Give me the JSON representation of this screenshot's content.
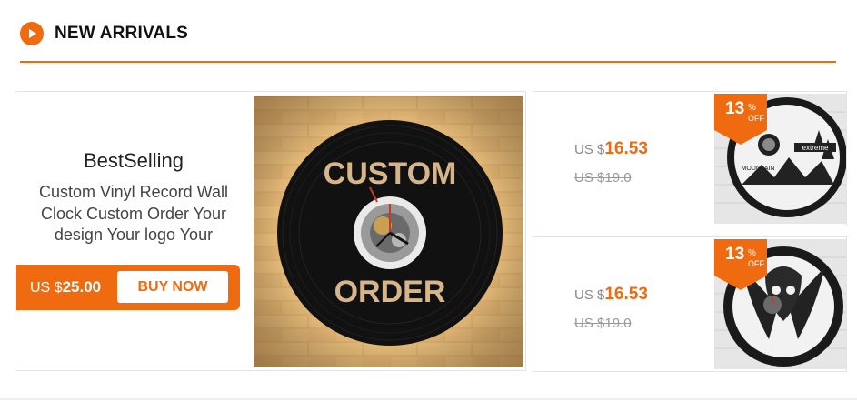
{
  "section": {
    "title": "NEW ARRIVALS",
    "icon": "play-circle-icon",
    "accent_color": "#f06a10"
  },
  "featured": {
    "title": "BestSelling",
    "description": "Custom Vinyl Record Wall Clock Custom Order Your design Your logo Your",
    "currency": "US $",
    "price": "25.00",
    "button_label": "BUY NOW",
    "image": {
      "top_text": "CUSTOM",
      "bottom_text": "ORDER"
    }
  },
  "products": [
    {
      "currency": "US $",
      "price": "16.53",
      "old_price": "US $19.0",
      "discount": "13",
      "discount_pct": "%",
      "discount_off": "OFF",
      "image_text_1": "extreme",
      "image_text_2": "MOUNTAIN"
    },
    {
      "currency": "US $",
      "price": "16.53",
      "old_price": "US $19.0",
      "discount": "13",
      "discount_pct": "%",
      "discount_off": "OFF"
    }
  ]
}
